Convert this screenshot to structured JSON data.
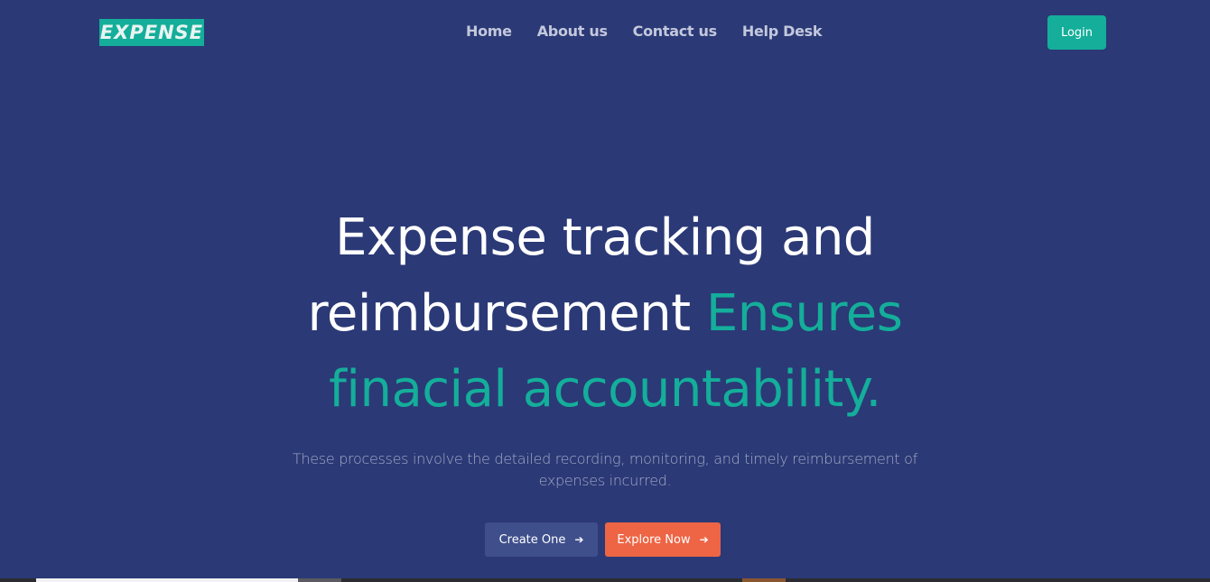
{
  "header": {
    "logo_text": "EXPENSE",
    "nav": [
      {
        "label": "Home"
      },
      {
        "label": "About us"
      },
      {
        "label": "Contact us"
      },
      {
        "label": "Help Desk"
      }
    ],
    "login_label": "Login"
  },
  "hero": {
    "title_line1": "Expense tracking and",
    "title_line2_plain": "reimbursement ",
    "title_line2_accent": "Ensures",
    "title_line3_accent": "finacial accountability.",
    "subtitle": "These processes involve the detailed recording, monitoring, and timely reimbursement of expenses incurred.",
    "primary_cta": "Create One",
    "secondary_cta": "Explore Now",
    "cta_icon": "arrow-right-icon"
  },
  "colors": {
    "background": "#2b3976",
    "accent": "#14ae9a",
    "secondary_button": "#ed6545",
    "primary_button": "#3f4f8c"
  }
}
